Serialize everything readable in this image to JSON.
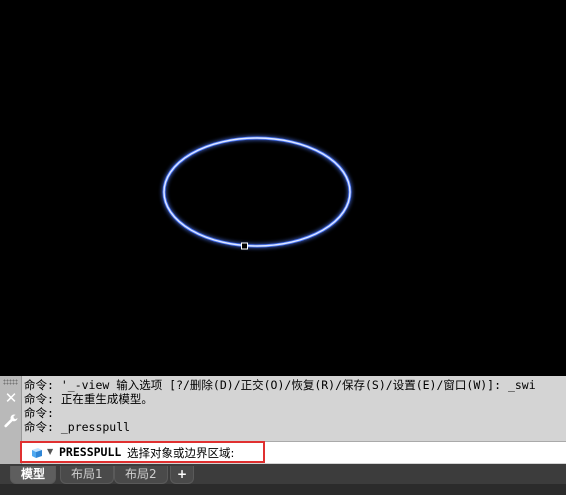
{
  "viewport": {
    "shape": "ellipse",
    "stroke_color": "#dfe8ff",
    "glow_color": "#4f7cff",
    "grip_color": "#ffffff"
  },
  "command_history": [
    "命令: '_-view 输入选项 [?/删除(D)/正交(O)/恢复(R)/保存(S)/设置(E)/窗口(W)]: _swi",
    "命令: 正在重生成模型。",
    "命令:",
    "命令: _presspull"
  ],
  "command_line": {
    "command": "PRESSPULL",
    "prompt": "选择对象或边界区域:",
    "highlight_color": "#e03030"
  },
  "tabs": [
    {
      "label": "模型",
      "active": true
    },
    {
      "label": "布局1",
      "active": false
    },
    {
      "label": "布局2",
      "active": false
    }
  ],
  "add_tab_label": "+",
  "icons": {
    "close": "close-icon",
    "customize": "wrench-icon",
    "command": "cube-icon"
  }
}
